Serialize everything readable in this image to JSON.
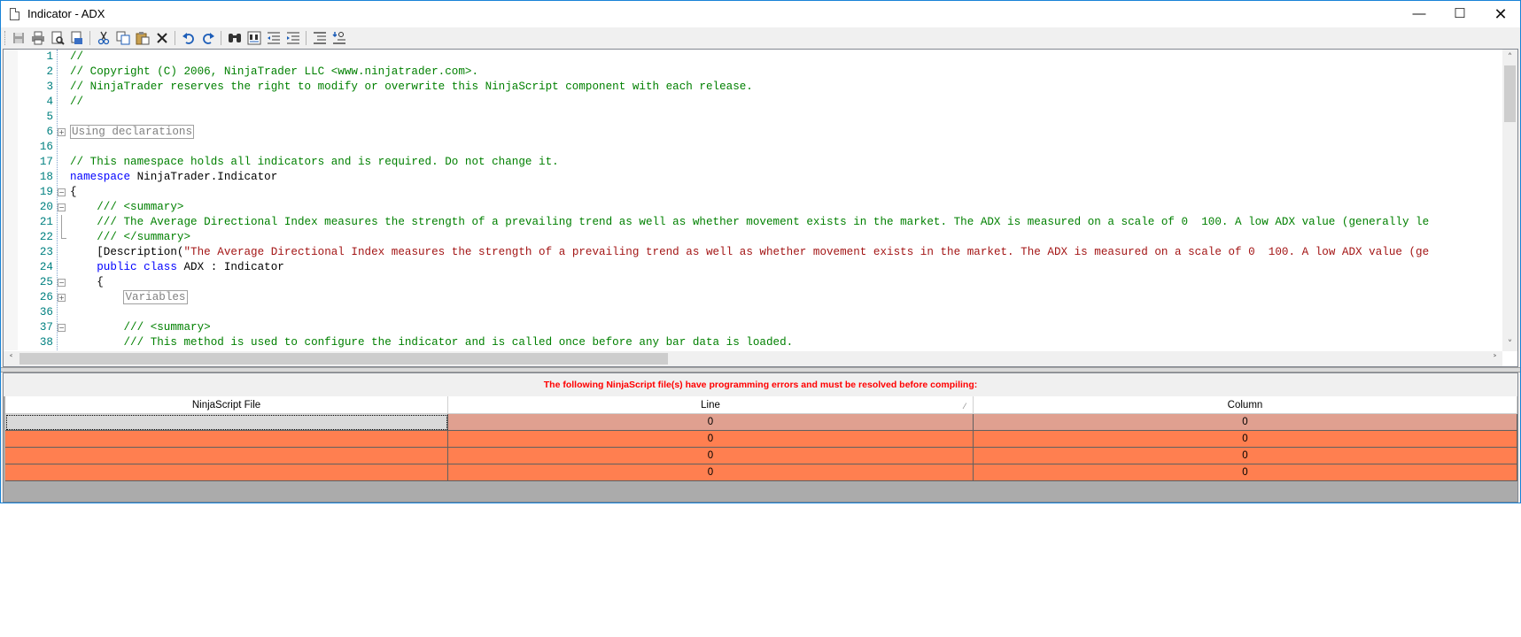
{
  "window": {
    "title": "Indicator - ADX",
    "colors": {
      "border": "#1883d7",
      "error_row": "#ff7f50",
      "error_row_selected": "#e0a090",
      "error_text": "#ff0000"
    }
  },
  "toolbar": {
    "buttons": [
      "save-icon",
      "print-icon",
      "print-preview-icon",
      "page-setup-icon",
      "cut-icon",
      "copy-icon",
      "paste-icon",
      "delete-icon",
      "undo-icon",
      "redo-icon",
      "find-icon",
      "replace-icon",
      "outdent-icon",
      "indent-icon",
      "comment-icon",
      "uncomment-icon"
    ]
  },
  "editor": {
    "lines": [
      {
        "num": "1",
        "text": "//"
      },
      {
        "num": "2",
        "text": "// Copyright (C) 2006, NinjaTrader LLC <www.ninjatrader.com>."
      },
      {
        "num": "3",
        "text": "// NinjaTrader reserves the right to modify or overwrite this NinjaScript component with each release."
      },
      {
        "num": "4",
        "text": "//"
      },
      {
        "num": "5",
        "text": ""
      },
      {
        "num": "6",
        "text": "Using declarations"
      },
      {
        "num": "16",
        "text": ""
      },
      {
        "num": "17",
        "text": "// This namespace holds all indicators and is required. Do not change it."
      },
      {
        "num": "18",
        "kw": "namespace",
        "text": " NinjaTrader.Indicator"
      },
      {
        "num": "19",
        "text": "{"
      },
      {
        "num": "20",
        "text": "    /// <summary>"
      },
      {
        "num": "21",
        "text": "    /// The Average Directional Index measures the strength of a prevailing trend as well as whether movement exists in the market. The ADX is measured on a scale of 0  100. A low ADX value (generally le"
      },
      {
        "num": "22",
        "text": "    /// </summary>"
      },
      {
        "num": "23",
        "pre": "    [Description(",
        "text": "\"The Average Directional Index measures the strength of a prevailing trend as well as whether movement exists in the market. The ADX is measured on a scale of 0  100. A low ADX value (ge"
      },
      {
        "num": "24",
        "kw": "public class",
        "text": " ADX : Indicator"
      },
      {
        "num": "25",
        "text": "    {"
      },
      {
        "num": "26",
        "text": "Variables"
      },
      {
        "num": "36",
        "text": ""
      },
      {
        "num": "37",
        "text": "        /// <summary>"
      },
      {
        "num": "38",
        "text": "        /// This method is used to configure the indicator and is called once before any bar data is loaded."
      }
    ]
  },
  "errors": {
    "message": "The following NinjaScript file(s) have programming errors and must be resolved before compiling:",
    "columns": [
      "NinjaScript File",
      "Line",
      "Column"
    ],
    "sort_indicator": "⁄",
    "rows": [
      {
        "file": "",
        "line": "0",
        "column": "0"
      },
      {
        "file": "",
        "line": "0",
        "column": "0"
      },
      {
        "file": "",
        "line": "0",
        "column": "0"
      },
      {
        "file": "",
        "line": "0",
        "column": "0"
      }
    ]
  }
}
